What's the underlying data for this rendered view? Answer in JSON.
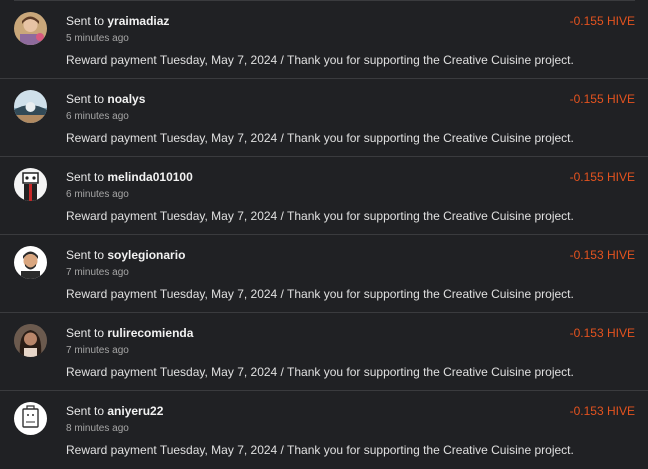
{
  "colors": {
    "background": "#202124",
    "divider": "#3a3b3e",
    "amount": "#e4531f",
    "text": "#e8e8e8",
    "muted": "#a6a6a6"
  },
  "transactions": [
    {
      "sent_prefix": "Sent to",
      "recipient": "yraimadiaz",
      "time_ago": "5 minutes ago",
      "memo": "Reward payment Tuesday, May 7, 2024 / Thank you for supporting the Creative Cuisine project.",
      "amount": "-0.155 HIVE",
      "avatar_icon": "user-avatar-photo"
    },
    {
      "sent_prefix": "Sent to",
      "recipient": "noalys",
      "time_ago": "6 minutes ago",
      "memo": "Reward payment Tuesday, May 7, 2024 / Thank you for supporting the Creative Cuisine project.",
      "amount": "-0.155 HIVE",
      "avatar_icon": "user-avatar-landscape"
    },
    {
      "sent_prefix": "Sent to",
      "recipient": "melinda010100",
      "time_ago": "6 minutes ago",
      "memo": "Reward payment Tuesday, May 7, 2024 / Thank you for supporting the Creative Cuisine project.",
      "amount": "-0.155 HIVE",
      "avatar_icon": "user-avatar-cartoon"
    },
    {
      "sent_prefix": "Sent to",
      "recipient": "soylegionario",
      "time_ago": "7 minutes ago",
      "memo": "Reward payment Tuesday, May 7, 2024 / Thank you for supporting the Creative Cuisine project.",
      "amount": "-0.153 HIVE",
      "avatar_icon": "user-avatar-cartoon-man"
    },
    {
      "sent_prefix": "Sent to",
      "recipient": "rulirecomienda",
      "time_ago": "7 minutes ago",
      "memo": "Reward payment Tuesday, May 7, 2024 / Thank you for supporting the Creative Cuisine project.",
      "amount": "-0.153 HIVE",
      "avatar_icon": "user-avatar-photo-woman"
    },
    {
      "sent_prefix": "Sent to",
      "recipient": "aniyeru22",
      "time_ago": "8 minutes ago",
      "memo": "Reward payment Tuesday, May 7, 2024 / Thank you for supporting the Creative Cuisine project.",
      "amount": "-0.153 HIVE",
      "avatar_icon": "user-avatar-logo"
    }
  ]
}
